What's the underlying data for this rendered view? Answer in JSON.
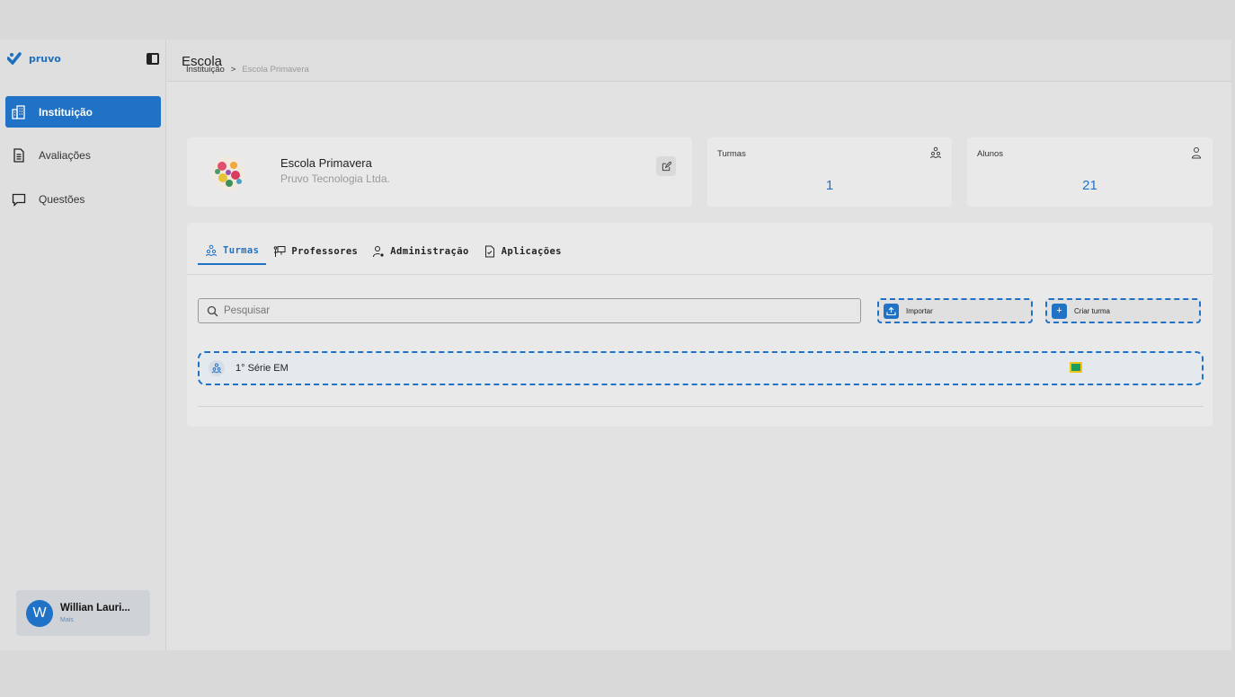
{
  "app": {
    "brand": "pruvo"
  },
  "sidebar": {
    "items": [
      {
        "label": "Instituição",
        "icon": "building-icon",
        "active": true
      },
      {
        "label": "Avaliações",
        "icon": "document-icon",
        "active": false
      },
      {
        "label": "Questões",
        "icon": "chat-icon",
        "active": false
      }
    ],
    "user": {
      "initial": "W",
      "name": "Willian Lauri...",
      "sub": "Mais"
    }
  },
  "header": {
    "title": "Escola"
  },
  "breadcrumb": {
    "root": "Instituição",
    "separator": ">",
    "current": "Escola Primavera"
  },
  "school": {
    "name": "Escola Primavera",
    "company": "Pruvo Tecnologia Ltda."
  },
  "stats": {
    "turmas": {
      "label": "Turmas",
      "value": "1"
    },
    "alunos": {
      "label": "Alunos",
      "value": "21"
    }
  },
  "tabs": [
    {
      "label": "Turmas",
      "active": true
    },
    {
      "label": "Professores",
      "active": false
    },
    {
      "label": "Administração",
      "active": false
    },
    {
      "label": "Aplicações",
      "active": false
    }
  ],
  "search": {
    "placeholder": "Pesquisar"
  },
  "actions": {
    "import_label": "Importar",
    "create_label": "Criar turma"
  },
  "classes": [
    {
      "name": "1° Série EM"
    }
  ],
  "colors": {
    "accent": "#1f72c6"
  }
}
